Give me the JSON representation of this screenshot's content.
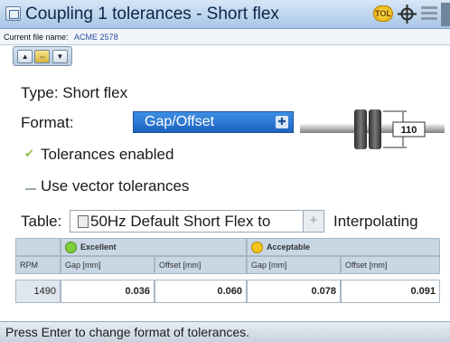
{
  "window": {
    "title": "Coupling 1 tolerances - Short flex",
    "tol_badge": "TOL"
  },
  "file": {
    "label": "Current file name:",
    "value": "ACME 2578"
  },
  "toolbar": {
    "buttons": [
      "▲",
      "⇔",
      "▼"
    ]
  },
  "type_line": "Type: Short flex",
  "format": {
    "label": "Format:",
    "value": "Gap/Offset"
  },
  "coupling_diameter": "110",
  "options": {
    "tolerances_enabled": {
      "label": "Tolerances enabled",
      "checked": true
    },
    "vector_tolerances": {
      "label": "Use vector tolerances",
      "checked": false
    }
  },
  "table_select": {
    "label": "Table:",
    "value": "50Hz Default Short Flex to",
    "mode": "Interpolating"
  },
  "tolerance_table": {
    "groups": [
      "Excellent",
      "Acceptable"
    ],
    "columns": [
      "RPM",
      "Gap [mm]",
      "Offset [mm]",
      "Gap [mm]",
      "Offset [mm]"
    ],
    "rows": [
      {
        "rpm": "1490",
        "exc_gap": "0.036",
        "exc_offset": "0.060",
        "acc_gap": "0.078",
        "acc_offset": "0.091"
      }
    ]
  },
  "status": "Press Enter to change format of tolerances.",
  "colors": {
    "format_select": "#2a7ad6",
    "title_bar": "#b9d0ea",
    "excellent": "#7fcf3a",
    "acceptable": "#f3c519"
  }
}
